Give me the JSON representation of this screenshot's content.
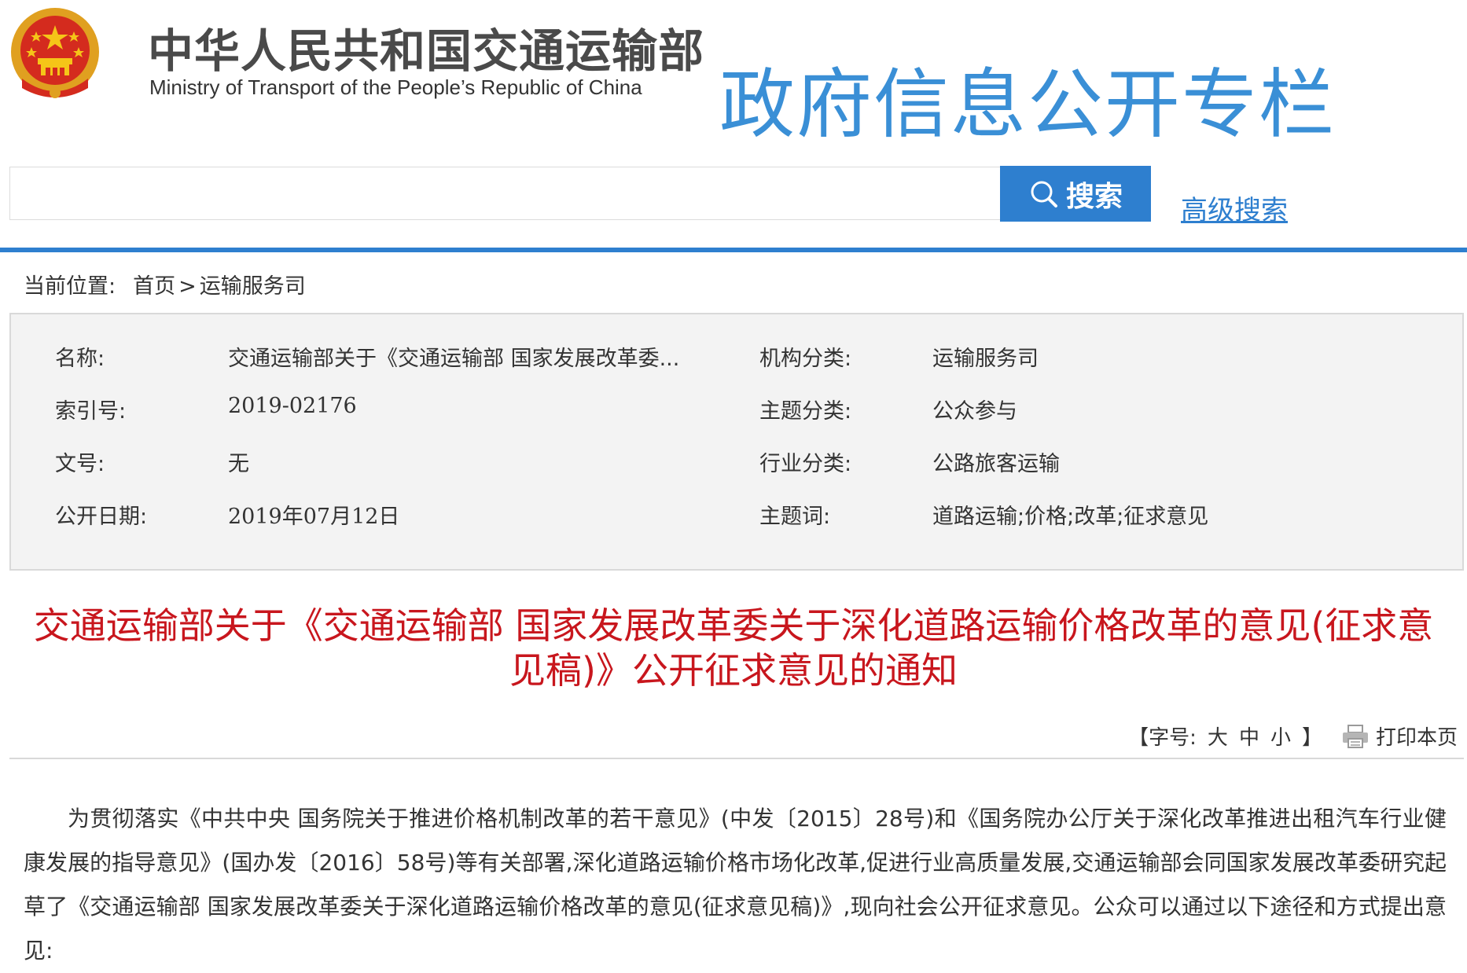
{
  "header": {
    "ministry_cn": "中华人民共和国交通运输部",
    "ministry_en": "Ministry of Transport of the People’s Republic of China",
    "column_title": "政府信息公开专栏",
    "emblem_icon": "national-emblem-icon"
  },
  "search": {
    "placeholder": "",
    "value": "",
    "button_label": "搜索",
    "advanced_label": "高级搜索"
  },
  "breadcrumb": {
    "label": "当前位置:",
    "home": "首页",
    "separator": ">",
    "current": "运输服务司"
  },
  "info": {
    "name_label": "名称:",
    "name_value": "交通运输部关于《交通运输部 国家发展改革委...",
    "index_label": "索引号:",
    "index_value": "2019-02176",
    "docno_label": "文号:",
    "docno_value": "无",
    "date_label": "公开日期:",
    "date_value": "2019年07月12日",
    "org_label": "机构分类:",
    "org_value": "运输服务司",
    "topic_label": "主题分类:",
    "topic_value": "公众参与",
    "industry_label": "行业分类:",
    "industry_value": "公路旅客运输",
    "keywords_label": "主题词:",
    "keywords_value": "道路运输;价格;改革;征求意见"
  },
  "article": {
    "title": "交通运输部关于《交通运输部 国家发展改革委关于深化道路运输价格改革的意见(征求意见稿)》公开征求意见的通知",
    "body": "为贯彻落实《中共中央 国务院关于推进价格机制改革的若干意见》(中发〔2015〕28号)和《国务院办公厅关于深化改革推进出租汽车行业健康发展的指导意见》(国办发〔2016〕58号)等有关部署,深化道路运输价格市场化改革,促进行业高质量发展,交通运输部会同国家发展改革委研究起草了《交通运输部 国家发展改革委关于深化道路运输价格改革的意见(征求意见稿)》,现向社会公开征求意见。公众可以通过以下途径和方式提出意见:"
  },
  "tools": {
    "font_size_open": "【字号:",
    "size_large": "大",
    "size_medium": "中",
    "size_small": "小",
    "font_size_close": "】",
    "print_label": "打印本页"
  },
  "colors": {
    "accent_blue": "#2e7fcf",
    "title_blue": "#3a8fd6",
    "headline_red": "#c8161d",
    "info_bg": "#f3f3f3"
  }
}
